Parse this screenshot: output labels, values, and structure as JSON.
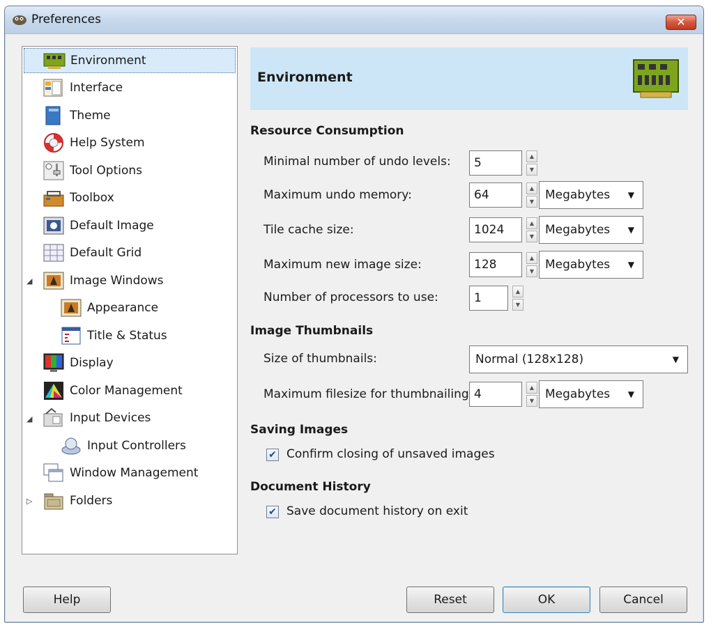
{
  "window": {
    "title": "Preferences",
    "close_glyph": "✕"
  },
  "sidebar": {
    "items": [
      {
        "label": "Environment",
        "icon": "circuit-board-icon"
      },
      {
        "label": "Interface",
        "icon": "interface-icon"
      },
      {
        "label": "Theme",
        "icon": "theme-icon"
      },
      {
        "label": "Help System",
        "icon": "lifebuoy-icon"
      },
      {
        "label": "Tool Options",
        "icon": "tool-options-icon"
      },
      {
        "label": "Toolbox",
        "icon": "toolbox-icon"
      },
      {
        "label": "Default Image",
        "icon": "default-image-icon"
      },
      {
        "label": "Default Grid",
        "icon": "grid-icon"
      },
      {
        "label": "Image Windows",
        "icon": "image-window-icon"
      },
      {
        "label": "Appearance",
        "icon": "appearance-icon"
      },
      {
        "label": "Title & Status",
        "icon": "title-status-icon"
      },
      {
        "label": "Display",
        "icon": "display-icon"
      },
      {
        "label": "Color Management",
        "icon": "color-management-icon"
      },
      {
        "label": "Input Devices",
        "icon": "input-devices-icon"
      },
      {
        "label": "Input Controllers",
        "icon": "input-controllers-icon"
      },
      {
        "label": "Window Management",
        "icon": "window-management-icon"
      },
      {
        "label": "Folders",
        "icon": "folders-icon"
      }
    ],
    "selected": "Environment"
  },
  "banner": {
    "title": "Environment",
    "icon": "circuit-board-icon"
  },
  "resource": {
    "title": "Resource Consumption",
    "undo_levels_label": "Minimal number of undo levels:",
    "undo_levels_value": "5",
    "undo_memory_label": "Maximum undo memory:",
    "undo_memory_value": "64",
    "undo_memory_unit": "Megabytes",
    "tile_cache_label": "Tile cache size:",
    "tile_cache_value": "1024",
    "tile_cache_unit": "Megabytes",
    "max_image_label": "Maximum new image size:",
    "max_image_value": "128",
    "max_image_unit": "Megabytes",
    "processors_label": "Number of processors to use:",
    "processors_value": "1"
  },
  "thumbnails": {
    "title": "Image Thumbnails",
    "size_label": "Size of thumbnails:",
    "size_value": "Normal (128x128)",
    "filesize_label": "Maximum filesize for thumbnailing:",
    "filesize_value": "4",
    "filesize_unit": "Megabytes"
  },
  "saving": {
    "title": "Saving Images",
    "confirm_label": "Confirm closing of unsaved images",
    "confirm_checked": true
  },
  "history": {
    "title": "Document History",
    "save_label": "Save document history on exit",
    "save_checked": true
  },
  "buttons": {
    "help": "Help",
    "reset": "Reset",
    "ok": "OK",
    "cancel": "Cancel"
  },
  "colors": {
    "banner_bg": "#cde6f7",
    "selection_bg": "#d9ebfb",
    "close_red": "#c23a22"
  }
}
